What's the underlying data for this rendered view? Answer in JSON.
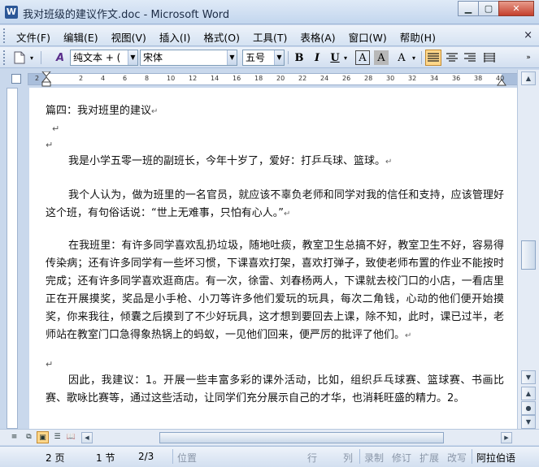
{
  "window": {
    "app_icon": "W",
    "title": "我对班级的建议作文.doc - Microsoft Word",
    "minimize_glyph": "▁",
    "maximize_glyph": "▢",
    "close_glyph": "✕"
  },
  "menu": {
    "items": [
      "文件(F)",
      "编辑(E)",
      "视图(V)",
      "插入(I)",
      "格式(O)",
      "工具(T)",
      "表格(A)",
      "窗口(W)",
      "帮助(H)"
    ],
    "close_glyph": "×"
  },
  "toolbar": {
    "style_value": "纯文本 + (",
    "font_value": "宋体",
    "size_value": "五号",
    "bold": "B",
    "italic": "I",
    "underline": "U",
    "char_border": "A",
    "char_shading": "A",
    "highlight": "A",
    "style_icon_label": "A",
    "accent": "#ffd78a"
  },
  "ruler": {
    "ticks": [
      "2",
      "",
      "2",
      "4",
      "6",
      "8",
      "10",
      "12",
      "14",
      "16",
      "18",
      "20",
      "22",
      "24",
      "26",
      "28",
      "30",
      "32",
      "34",
      "36",
      "38",
      "40"
    ]
  },
  "document": {
    "paragraphs": [
      "篇四：我对班里的建议",
      "我是小学五零一班的副班长，今年十岁了，爱好：打乒乓球、篮球。",
      "我个人认为，做为班里的一名官员，就应该不辜负老师和同学对我的信任和支持，应该管理好这个班，有句俗话说：“世上无难事，只怕有心人。”",
      "在我班里：有许多同学喜欢乱扔垃圾，随地吐痰，教室卫生总搞不好，教室卫生不好，容易得传染病；还有许多同学有一些坏习惯，下课喜欢打架，喜欢打弹子，致使老师布置的作业不能按时完成；还有许多同学喜欢逛商店。有一次，徐雷、刘春杨两人，下课就去校门口的小店，一看店里正在开展摸奖，奖品是小手枪、小刀等许多他们爱玩的玩具，每次二角钱，心动的他们便开始摸奖，你来我往，倾囊之后摸到了不少好玩具，这才想到要回去上课，除不知，此时，课已过半，老师站在教室门口急得象热锅上的蚂蚁，一见他们回来，便严厉的批评了他们。",
      "因此，我建议：1。开展一些丰富多彩的课外活动，比如，组织乒乓球赛、篮球赛、书画比赛、歌咏比赛等，通过这些活动，让同学们充分展示自己的才华，也消耗旺盛的精力。2。"
    ],
    "return_mark": "↵"
  },
  "scroll": {
    "up": "▲",
    "down": "▼",
    "left": "◀",
    "right": "▶",
    "prev_page": "▲",
    "browse": "●",
    "next_page": "▼"
  },
  "views": [
    "≡",
    "⧉",
    "▣",
    "☰",
    "📖"
  ],
  "status": {
    "page": "2 页",
    "section": "1 节",
    "page_of": "2/3",
    "position": "位置",
    "line": "行",
    "column": "列",
    "record": "录制",
    "revise": "修订",
    "extend": "扩展",
    "overwrite": "改写",
    "language": "阿拉伯语"
  }
}
